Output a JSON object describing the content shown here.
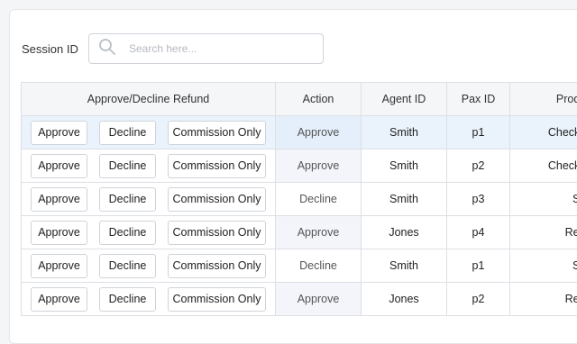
{
  "search": {
    "label": "Session ID",
    "placeholder": "Search here..."
  },
  "table": {
    "headers": {
      "approve_decline": "Approve/Decline Refund",
      "action": "Action",
      "agent_id": "Agent ID",
      "pax_id": "Pax ID",
      "product": "Product"
    },
    "buttons": {
      "approve": "Approve",
      "decline": "Decline",
      "commission": "Commission Only"
    },
    "rows": [
      {
        "action": "Approve",
        "agent": "Smith",
        "pax": "p1",
        "product": "Checking"
      },
      {
        "action": "Approve",
        "agent": "Smith",
        "pax": "p2",
        "product": "Checking"
      },
      {
        "action": "Decline",
        "agent": "Smith",
        "pax": "p3",
        "product": "Ship"
      },
      {
        "action": "Approve",
        "agent": "Jones",
        "pax": "p4",
        "product": "Refun"
      },
      {
        "action": "Decline",
        "agent": "Smith",
        "pax": "p1",
        "product": "Ship"
      },
      {
        "action": "Approve",
        "agent": "Jones",
        "pax": "p2",
        "product": "Refun"
      }
    ]
  }
}
